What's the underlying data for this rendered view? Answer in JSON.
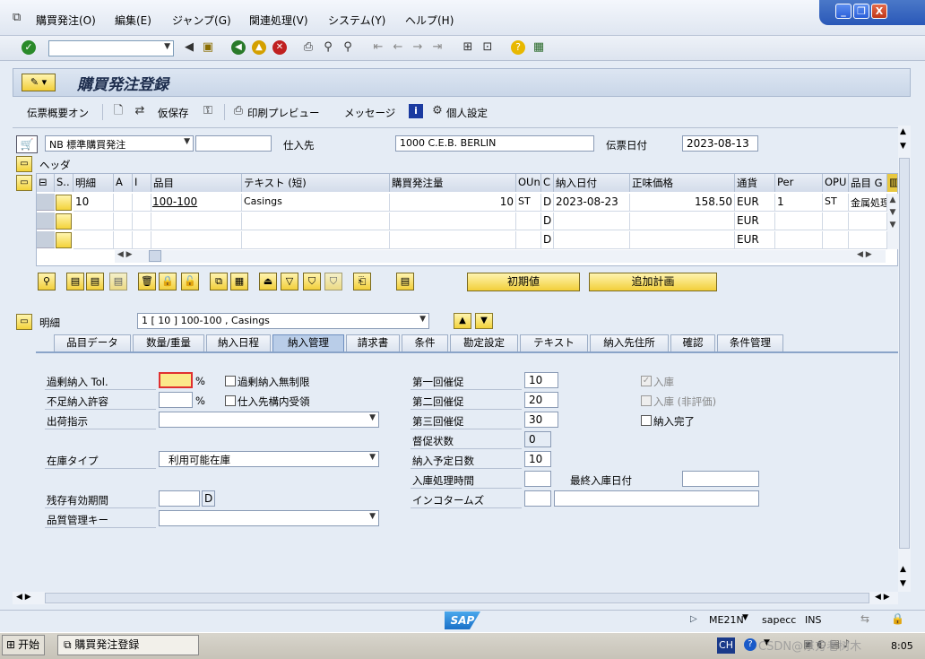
{
  "menu": {
    "items": [
      "購買発注(O)",
      "編集(E)",
      "ジャンプ(G)",
      "関連処理(V)",
      "システム(Y)",
      "ヘルプ(H)"
    ]
  },
  "window": {
    "min": "_",
    "restore": "❐",
    "close": "X"
  },
  "header": {
    "title": "購買発注登録"
  },
  "app_toolbar": {
    "doc_overview": "伝票概要オン",
    "hold": "仮保存",
    "print_preview": "印刷プレビュー",
    "messages": "メッセージ",
    "personal": "個人設定"
  },
  "po": {
    "type_value": "NB 標準購買発注",
    "vendor_label": "仕入先",
    "vendor_value": "1000 C.E.B. BERLIN",
    "doc_date_label": "伝票日付",
    "doc_date_value": "2023-08-13",
    "header_label": "ヘッダ"
  },
  "grid": {
    "columns": [
      "S..",
      "明細",
      "A",
      "I",
      "品目",
      "テキスト (短)",
      "購買発注量",
      "OUn",
      "C",
      "納入日付",
      "正味価格",
      "通貨",
      "Per",
      "OPU",
      "品目 G"
    ],
    "rows": [
      {
        "item": "10",
        "material": "100-100",
        "text": "Casings",
        "qty": "10",
        "oun": "ST",
        "c": "D",
        "date": "2023-08-23",
        "price": "158.50",
        "curr": "EUR",
        "per": "1",
        "opu": "ST",
        "mg": "金属処理"
      },
      {
        "item": "",
        "material": "",
        "text": "",
        "qty": "",
        "oun": "",
        "c": "D",
        "date": "",
        "price": "",
        "curr": "EUR",
        "per": "",
        "opu": "",
        "mg": ""
      },
      {
        "item": "",
        "material": "",
        "text": "",
        "qty": "",
        "oun": "",
        "c": "D",
        "date": "",
        "price": "",
        "curr": "EUR",
        "per": "",
        "opu": "",
        "mg": ""
      }
    ]
  },
  "buttons": {
    "default": "初期値",
    "add_plan": "追加計画"
  },
  "detail": {
    "label": "明細",
    "select_value": "1 [ 10 ] 100-100 , Casings"
  },
  "tabs": [
    "品目データ",
    "数量/重量",
    "納入日程",
    "納入管理",
    "請求書",
    "条件",
    "勘定設定",
    "テキスト",
    "納入先住所",
    "確認",
    "条件管理"
  ],
  "delivery": {
    "overdel_label": "過剰納入 Tol.",
    "pct": "%",
    "unlimited_label": "過剰納入無制限",
    "underdel_label": "不足納入許容",
    "pct2": "%",
    "gr_label": "仕入先構内受領",
    "shipping_label": "出荷指示",
    "stock_type_label": "在庫タイプ",
    "stock_type_value": "利用可能在庫",
    "shelf_label": "残存有効期間",
    "shelf_unit": "D",
    "qm_label": "品質管理キー",
    "rem1_label": "第一回催促",
    "rem1": "10",
    "rem2_label": "第二回催促",
    "rem2": "20",
    "rem3_label": "第三回催促",
    "rem3": "30",
    "dun_label": "督促状数",
    "dun": "0",
    "plan_label": "納入予定日数",
    "plan": "10",
    "gr_time_label": "入庫処理時間",
    "last_gr_label": "最終入庫日付",
    "inco_label": "インコタームズ",
    "gr_check_label": "入庫",
    "gr_nonval_label": "入庫 (非評価)",
    "del_complete_label": "納入完了"
  },
  "status": {
    "tcode": "ME21N",
    "system": "sapecc",
    "mode": "INS",
    "sap": "SAP"
  },
  "taskbar": {
    "start": "开始",
    "task": "購買発注登録",
    "lang": "CH",
    "time": "8:05",
    "watermark": "CSDN@东方老树木"
  }
}
